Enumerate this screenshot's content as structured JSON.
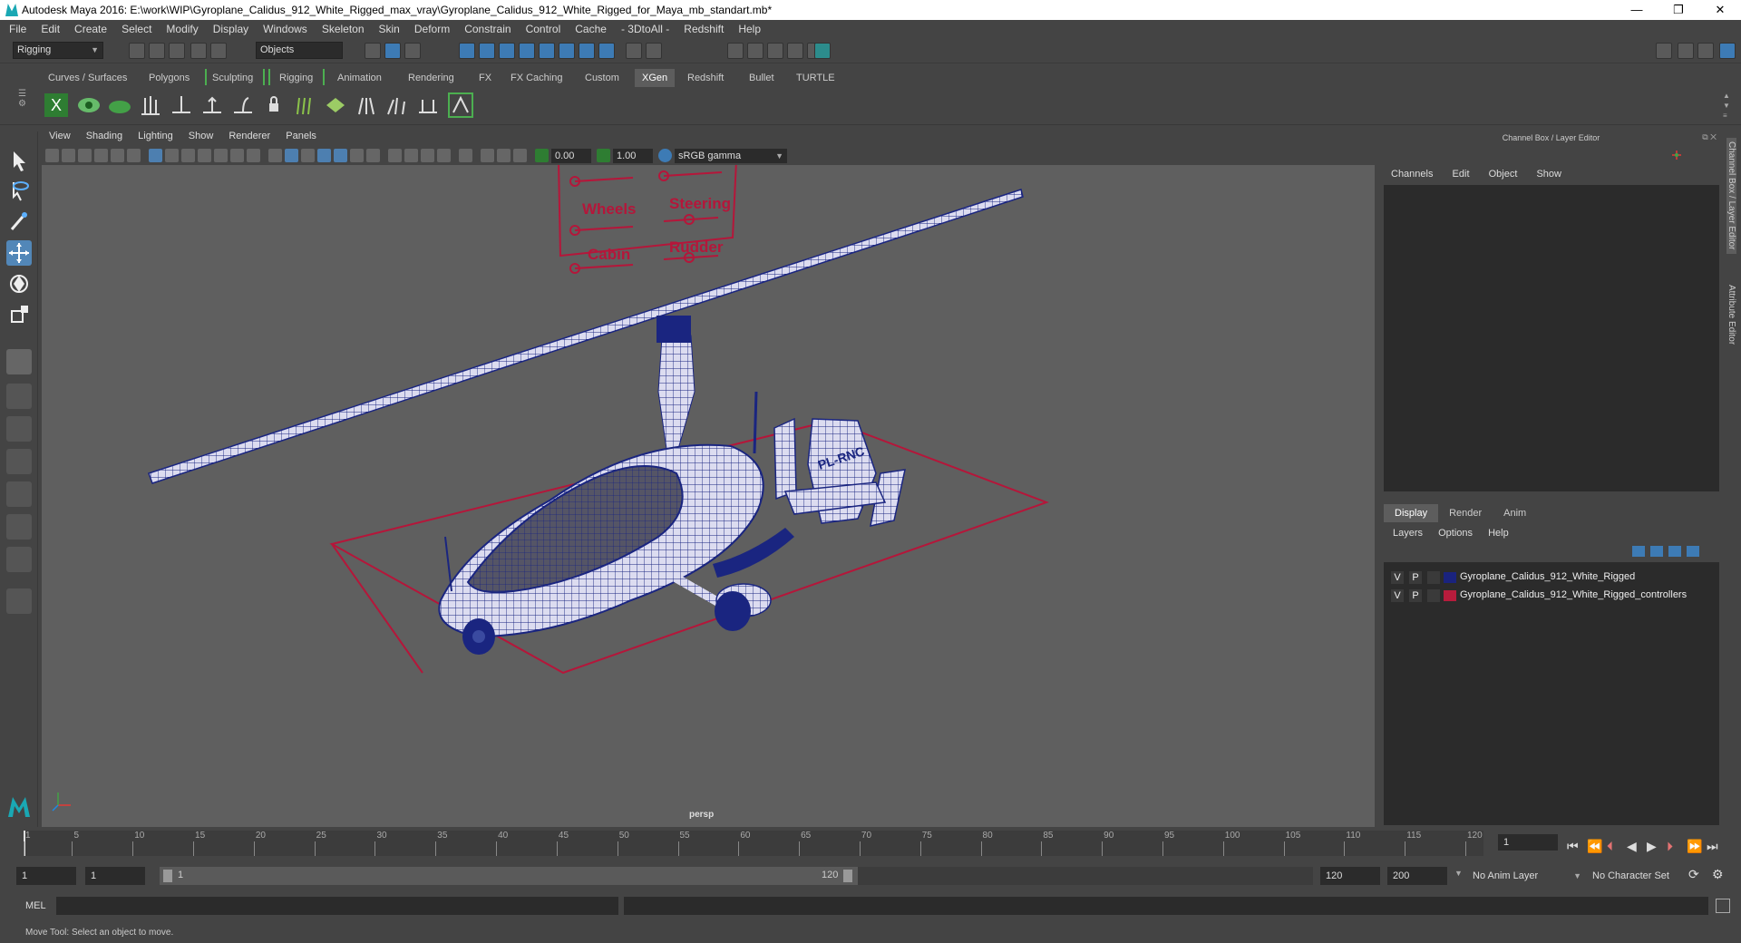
{
  "title_bar": {
    "title": "Autodesk Maya 2016: E:\\work\\WIP\\Gyroplane_Calidus_912_White_Rigged_max_vray\\Gyroplane_Calidus_912_White_Rigged_for_Maya_mb_standart.mb*",
    "minimize": "—",
    "maximize": "❐",
    "close": "✕"
  },
  "menu": [
    "File",
    "Edit",
    "Create",
    "Select",
    "Modify",
    "Display",
    "Windows",
    "Skeleton",
    "Skin",
    "Deform",
    "Constrain",
    "Control",
    "Cache",
    "- 3DtoAll -",
    "Redshift",
    "Help"
  ],
  "status_line": {
    "menuset": "Rigging",
    "selection_mode": "Objects"
  },
  "shelf_tabs": [
    "Curves / Surfaces",
    "Polygons",
    "Sculpting",
    "Rigging",
    "Animation",
    "Rendering",
    "FX",
    "FX Caching",
    "Custom",
    "XGen",
    "Redshift",
    "Bullet",
    "TURTLE"
  ],
  "shelf_active_tab": "XGen",
  "viewport_menu": [
    "View",
    "Shading",
    "Lighting",
    "Show",
    "Renderer",
    "Panels"
  ],
  "viewport_toolbar": {
    "exposure": "0.00",
    "gamma": "1.00",
    "color_space": "sRGB gamma"
  },
  "viewport": {
    "camera": "persp",
    "controller_labels": [
      "Wheels",
      "Steering",
      "Cabin",
      "Rudder"
    ],
    "tail_text": "PL-RNC"
  },
  "channel_box": {
    "title": "Channel Box / Layer Editor",
    "menu": [
      "Channels",
      "Edit",
      "Object",
      "Show"
    ]
  },
  "layer_editor": {
    "tabs": [
      "Display",
      "Render",
      "Anim"
    ],
    "menu": [
      "Layers",
      "Options",
      "Help"
    ],
    "layers": [
      {
        "v": "V",
        "p": "P",
        "color": "#1a237e",
        "name": "Gyroplane_Calidus_912_White_Rigged"
      },
      {
        "v": "V",
        "p": "P",
        "color": "#b71c3c",
        "name": "Gyroplane_Calidus_912_White_Rigged_controllers"
      }
    ]
  },
  "side_tabs": [
    "Channel Box / Layer Editor",
    "Attribute Editor"
  ],
  "time_slider": {
    "ticks": [
      "1",
      "5",
      "10",
      "15",
      "20",
      "25",
      "30",
      "35",
      "40",
      "45",
      "50",
      "55",
      "60",
      "65",
      "70",
      "75",
      "80",
      "85",
      "90",
      "95",
      "100",
      "105",
      "110",
      "115",
      "120"
    ],
    "current_frame": "1"
  },
  "range_slider": {
    "start": "1",
    "anim_start": "1",
    "range_start": "1",
    "range_end": "120",
    "anim_end": "120",
    "end": "200",
    "anim_layer": "No Anim Layer",
    "character_set": "No Character Set"
  },
  "command_line": {
    "label": "MEL"
  },
  "help_line": "Move Tool: Select an object to move."
}
